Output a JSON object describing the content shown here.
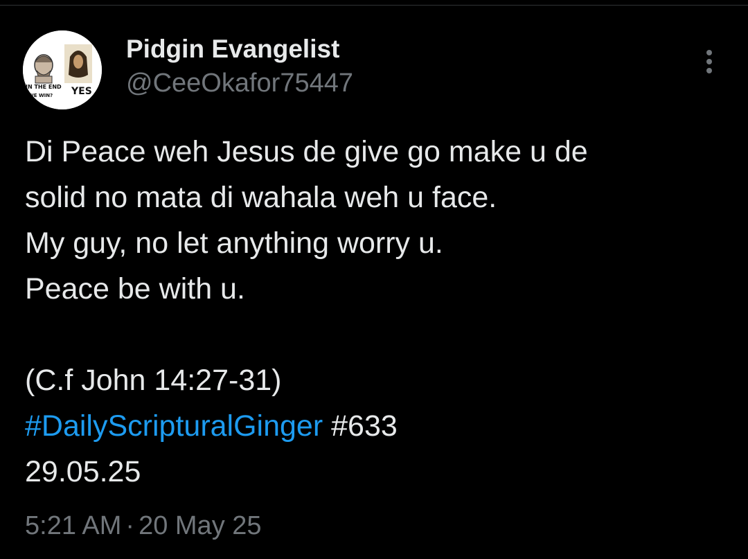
{
  "author": {
    "display_name": "Pidgin Evangelist",
    "handle": "@CeeOkafor75447",
    "avatar": {
      "text_left_line1": "IN THE END",
      "text_left_line2": "WE WIN?",
      "text_right": "YES"
    }
  },
  "tweet": {
    "lines": [
      "Di Peace weh Jesus de give go make u de",
      "solid no mata di wahala weh u face.",
      "My guy, no let anything worry u.",
      "Peace be with u."
    ],
    "reference": "(C.f John 14:27-31)",
    "hashtag": "#DailyScripturalGinger",
    "number_tag": "#633",
    "date_line": "29.05.25"
  },
  "meta": {
    "time": "5:21 AM",
    "separator": "·",
    "date": "20 May 25"
  },
  "colors": {
    "background": "#000000",
    "text": "#e7e9ea",
    "secondary": "#71767b",
    "link": "#1d9bf0"
  },
  "icons": {
    "more": "more-vertical-icon"
  }
}
